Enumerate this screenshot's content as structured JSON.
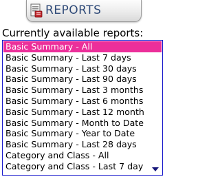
{
  "header": {
    "title": "REPORTS",
    "icon": "reports-icon"
  },
  "section": {
    "label": "Currently available reports:"
  },
  "reports": {
    "selected_index": 0,
    "items": [
      "Basic Summary - All",
      "Basic Summary - Last 7 days",
      "Basic Summary - Last 30 days",
      "Basic Summary - Last 90 days",
      "Basic Summary - Last 3 months",
      "Basic Summary - Last 6 months",
      "Basic Summary - Last 12 month",
      "Basic Summary - Month to Date",
      "Basic Summary - Year to Date",
      "Basic Summary - Last 28 days",
      "Category and Class - All",
      "Category and Class - Last 7 day"
    ],
    "scroll_indicator": "scroll-down-arrow-icon"
  },
  "colors": {
    "selection": "#ec2f9a",
    "list_border": "#1a1acc",
    "title_text": "#2f4a78",
    "scroll_arrow": "#16167a"
  }
}
